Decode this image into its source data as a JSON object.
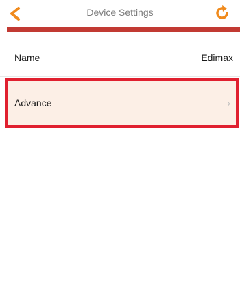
{
  "header": {
    "title": "Device Settings",
    "back_icon": "chevron-left-icon",
    "refresh_icon": "refresh-icon",
    "accent_color": "#c23a33",
    "icon_color": "#f08a1c"
  },
  "settings": {
    "name_label": "Name",
    "name_value": "Edimax",
    "advance_label": "Advance",
    "advance_chevron": "›",
    "highlight_color": "#e0202f"
  }
}
